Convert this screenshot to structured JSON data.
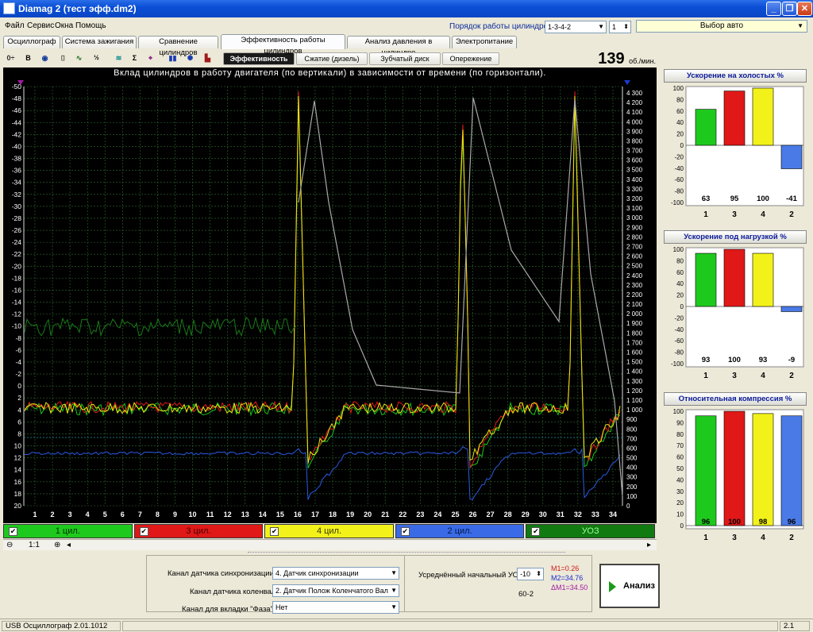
{
  "window": {
    "title": "Diamag 2 (тест эфф.dm2)"
  },
  "menu": [
    "Файл",
    "Сервис",
    "Окна",
    "Помощь"
  ],
  "header": {
    "order_label": "Порядок работы цилиндров",
    "order_value": "1-3-4-2",
    "cyl_value": "1",
    "car_select": "Выбор авто"
  },
  "tabs": [
    "Осциллограф",
    "Система зажигания",
    "Сравнение цилиндров",
    "Эффективность работы цилиндров",
    "Анализ давления в цилиндре",
    "Электропитание"
  ],
  "active_tab": 3,
  "toolbar_icons": [
    "sync-icon",
    "bold-b-icon",
    "rpm-gauge-icon",
    "scale-icon",
    "curve-icon",
    "algorithm-icon",
    "filter-icon",
    "sum-icon",
    "cursor-icon",
    "cylinders-icon",
    "uoz-icon",
    "bar-icon"
  ],
  "subtabs": [
    "Эффективность",
    "Сжатие (дизель)",
    "Зубчатый диск",
    "Опережение"
  ],
  "rpm": {
    "value": "139",
    "unit": "об./мин."
  },
  "plot": {
    "title": "Вклад цилиндров в работу двигателя (по вертикали) в зависимости от времени (по горизонтали).",
    "left_ticks": [
      "-50",
      "-48",
      "-46",
      "-44",
      "-42",
      "-40",
      "-38",
      "-36",
      "-34",
      "-32",
      "-30",
      "-28",
      "-26",
      "-24",
      "-22",
      "-20",
      "-18",
      "-16",
      "-14",
      "-12",
      "-10",
      "-8",
      "-6",
      "-4",
      "-2",
      "0",
      "2",
      "4",
      "6",
      "8",
      "10",
      "12",
      "14",
      "16",
      "18",
      "20"
    ],
    "right_ticks": [
      "4 300",
      "4 200",
      "4 100",
      "4 000",
      "3 900",
      "3 800",
      "3 700",
      "3 600",
      "3 500",
      "3 400",
      "3 300",
      "3 200",
      "3 100",
      "3 000",
      "2 900",
      "2 800",
      "2 700",
      "2 600",
      "2 500",
      "2 400",
      "2 300",
      "2 200",
      "2 100",
      "2 000",
      "1 900",
      "1 800",
      "1 700",
      "1 600",
      "1 500",
      "1 400",
      "1 300",
      "1 200",
      "1 100",
      "1 000",
      "900",
      "800",
      "700",
      "600",
      "500",
      "400",
      "300",
      "200",
      "100",
      "0"
    ],
    "x_ticks": [
      "1",
      "2",
      "3",
      "4",
      "5",
      "6",
      "7",
      "8",
      "9",
      "10",
      "11",
      "12",
      "13",
      "14",
      "15",
      "16",
      "17",
      "18",
      "19",
      "20",
      "21",
      "22",
      "23",
      "24",
      "25",
      "26",
      "27",
      "28",
      "29",
      "30",
      "31",
      "32",
      "33",
      "34"
    ],
    "colors": {
      "bg": "#000000",
      "grid": "#2f6f2f",
      "cyl1": "#19c619",
      "cyl3": "#e21919",
      "cyl4": "#eaea10",
      "cyl2": "#2a5ae0",
      "uoz": "#1a7a1a",
      "rpm": "#a8a8a8"
    }
  },
  "legend": [
    {
      "label": "1 цил.",
      "color": "#1ec91e",
      "text": "#003300"
    },
    {
      "label": "3 цил.",
      "color": "#e01818",
      "text": "#4a0000"
    },
    {
      "label": "4 цил.",
      "color": "#f2f21a",
      "text": "#3a3a00"
    },
    {
      "label": "2 цил.",
      "color": "#3a6ae6",
      "text": "#001a4a"
    },
    {
      "label": "УОЗ",
      "color": "#117a11",
      "text": "#9aff9a"
    }
  ],
  "hscroll": {
    "zoom": "1:1"
  },
  "mini_charts": [
    {
      "title": "Ускорение на холостых %",
      "categories": [
        "1",
        "3",
        "4",
        "2"
      ],
      "values": [
        63,
        95,
        100,
        -41
      ],
      "value_labels": [
        "63",
        "95",
        "100",
        "-41"
      ],
      "yticks": [
        "100",
        "80",
        "60",
        "40",
        "20",
        "0",
        "-20",
        "-40",
        "-60",
        "-80",
        "-100"
      ]
    },
    {
      "title": "Ускорение под нагрузкой %",
      "categories": [
        "1",
        "3",
        "4",
        "2"
      ],
      "values": [
        93,
        100,
        93,
        -9
      ],
      "value_labels": [
        "93",
        "100",
        "93",
        "-9"
      ],
      "yticks": [
        "100",
        "80",
        "60",
        "40",
        "20",
        "0",
        "-20",
        "-40",
        "-60",
        "-80",
        "-100"
      ]
    },
    {
      "title": "Относительная компрессия %",
      "categories": [
        "1",
        "3",
        "4",
        "2"
      ],
      "values": [
        96,
        100,
        98,
        96
      ],
      "value_labels": [
        "96",
        "100",
        "98",
        "96"
      ],
      "yticks": [
        "100",
        "90",
        "80",
        "70",
        "60",
        "50",
        "40",
        "30",
        "20",
        "10",
        "0"
      ]
    }
  ],
  "bottom": {
    "sync_label": "Канал датчика синхронизации",
    "sync_value": "4. Датчик синхронизации",
    "crank_label": "Канал датчика коленвала",
    "crank_value": "2. Датчик Полож Коленчатого Вал",
    "phase_label": "Канал для вкладки \"Фаза\"",
    "phase_value": "Нет",
    "uoz_label": "Усреднённый начальный УОЗ",
    "uoz_value": "-10",
    "scheme": "60-2",
    "m1": "M1=0.26",
    "m2": "M2=34.76",
    "dm1": "ΔM1=34.50",
    "analyze_label": "Анализ"
  },
  "status": {
    "left": "USB Осциллограф  2.01.1012",
    "right": "2.1"
  }
}
